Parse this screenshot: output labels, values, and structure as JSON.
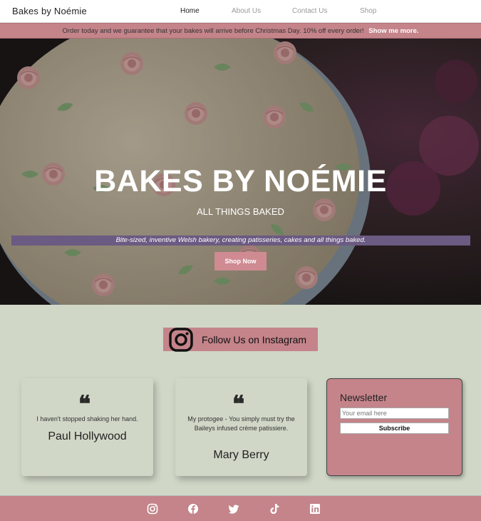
{
  "nav": {
    "brand": "Bakes by Noémie",
    "links": [
      "Home",
      "About Us",
      "Contact Us",
      "Shop"
    ]
  },
  "promo": {
    "text": "Order today and we guarantee that your bakes will arrive before Christmas Day. 10% off every order!",
    "link": "Show me more."
  },
  "hero": {
    "title": "BAKES BY NOÉMIE",
    "subtitle": "ALL THINGS BAKED",
    "tagline": "Bite-sized, inventive Welsh bakery, creating patisseries, cakes and all things baked.",
    "cta": "Shop Now"
  },
  "instagram": {
    "label": "Follow Us on Instagram"
  },
  "testimonials": [
    {
      "quote_mark": "❝",
      "text": "I haven't stopped shaking her hand.",
      "author": "Paul Hollywood"
    },
    {
      "quote_mark": "❝",
      "text": "My protogee - You simply must try the Baileys infused crème patissiere.",
      "author": "Mary Berry"
    }
  ],
  "newsletter": {
    "title": "Newsletter",
    "placeholder": "Your email here",
    "button": "Subscribe"
  },
  "footer": {
    "social_icons": [
      "instagram-icon",
      "facebook-icon",
      "twitter-icon",
      "tiktok-icon",
      "linkedin-icon"
    ]
  },
  "colors": {
    "accent": "#c4848a",
    "background": "#d0d7c7",
    "tagline_strip": "#6b5a82"
  }
}
